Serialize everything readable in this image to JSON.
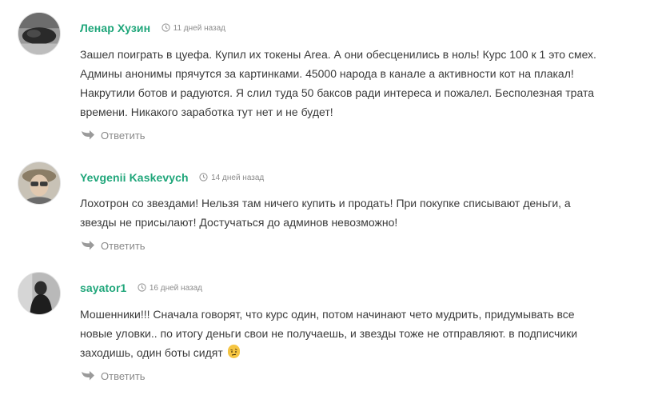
{
  "comments": [
    {
      "author": "Ленар Хузин",
      "date": "11 дней назад",
      "lines": [
        "Зашел поиграть в цуефа. Купил их токены Area. А они обесценились в ноль! Курс 100 к 1 это смех.",
        "Админы анонимы прячутся за картинками. 45000 народа в канале а активности кот на плакал!",
        "Накрутили ботов и радуются. Я слил туда 50 баксов ради интереса и пожалел. Бесполезная трата",
        "времени. Никакого заработка тут нет и не будет!"
      ],
      "reply_label": "Ответить"
    },
    {
      "author": "Yevgenii Kaskevych",
      "date": "14 дней назад",
      "lines": [
        "Лохотрон со звездами! Нельзя там ничего купить и продать! При покупке списывают деньги, а",
        "звезды не присылают! Достучаться до админов невозможно!"
      ],
      "reply_label": "Ответить"
    },
    {
      "author": "sayator1",
      "date": "16 дней назад",
      "lines": [
        "Мошенники!!! Сначала говорят, что курс один, потом начинают чето мудрить, придумывать все",
        "новые уловки.. по итогу деньги свои не получаешь, и звезды тоже не отправляют. в подписчики",
        "заходишь, один боты сидят"
      ],
      "emoji": "face-with-raised-eyebrow-emoji",
      "reply_label": "Ответить"
    }
  ],
  "icons": {
    "clock": "clock-icon",
    "reply": "reply-arrow-icon"
  },
  "colors": {
    "author": "#1fa67a",
    "meta": "#8c8c8c",
    "text": "#3b3b3b",
    "reply": "#8a8a8a",
    "emoji": "#f5c542"
  }
}
